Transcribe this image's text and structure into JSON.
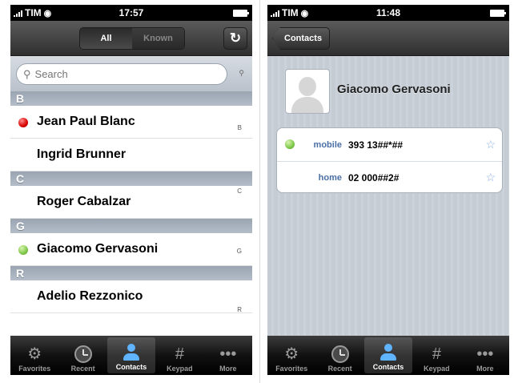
{
  "left_phone": {
    "status": {
      "carrier": "TIM",
      "time": "17:57"
    },
    "nav": {
      "segments": [
        "All",
        "Known"
      ],
      "refresh_icon": "refresh-icon"
    },
    "search": {
      "placeholder": "Search"
    },
    "sections": [
      {
        "letter": "B",
        "rows": [
          {
            "name": "Jean Paul Blanc",
            "status": "busy",
            "status_color": "#d70000"
          },
          {
            "name": "Ingrid Brunner",
            "status": "none"
          }
        ]
      },
      {
        "letter": "C",
        "rows": [
          {
            "name": "Roger Cabalzar",
            "status": "none"
          }
        ]
      },
      {
        "letter": "G",
        "rows": [
          {
            "name": "Giacomo Gervasoni",
            "status": "available",
            "status_color": "#7fc84a"
          }
        ]
      },
      {
        "letter": "R",
        "rows": [
          {
            "name": "Adelio Rezzonico",
            "status": "none"
          }
        ]
      }
    ],
    "index": [
      "B",
      "C",
      "G",
      "R"
    ]
  },
  "right_phone": {
    "status": {
      "carrier": "TIM",
      "time": "11:48"
    },
    "nav": {
      "back_label": "Contacts"
    },
    "contact": {
      "name": "Giacomo Gervasoni",
      "phones": [
        {
          "label": "mobile",
          "number": "393 13##*##",
          "status": "available"
        },
        {
          "label": "home",
          "number": "02 000##2#",
          "status": "none"
        }
      ]
    }
  },
  "tabbar": {
    "tabs": [
      {
        "label": "Favorites",
        "icon": "gear-icon"
      },
      {
        "label": "Recent",
        "icon": "clock-icon"
      },
      {
        "label": "Contacts",
        "icon": "person-icon",
        "active": true
      },
      {
        "label": "Keypad",
        "icon": "hash-icon"
      },
      {
        "label": "More",
        "icon": "ellipsis-icon"
      }
    ]
  },
  "colors": {
    "accent": "#5fb3ff",
    "online": "#7fc84a",
    "busy": "#d70000",
    "section_header": "#a6b0bc"
  }
}
